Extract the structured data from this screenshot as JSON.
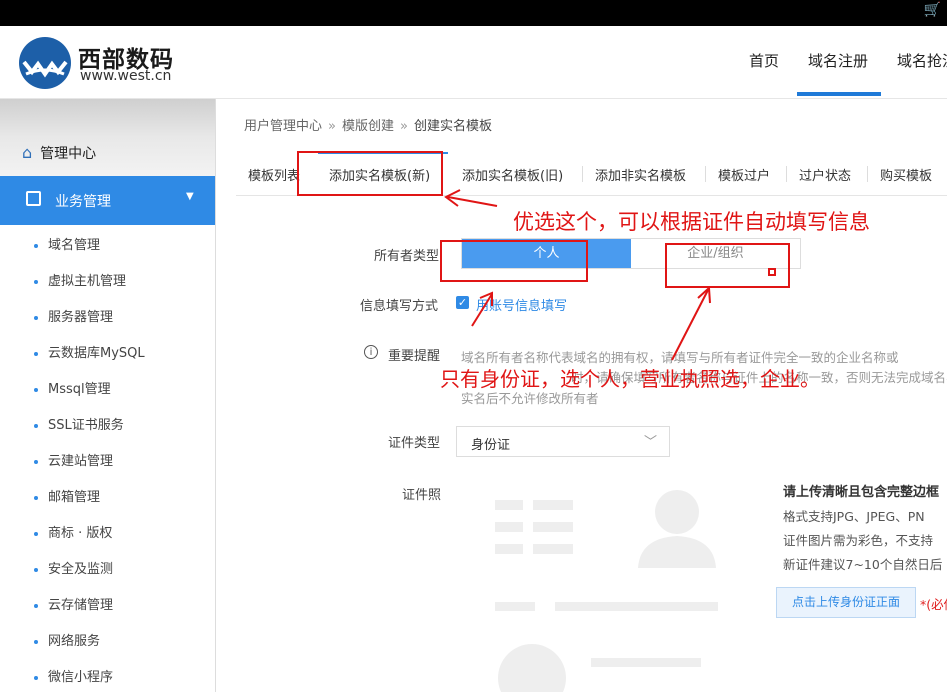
{
  "header": {
    "logo_cn": "西部数码",
    "logo_en": "www.west.cn",
    "nav": [
      "首页",
      "域名注册",
      "域名抢注"
    ]
  },
  "sidebar": {
    "home": "管理中心",
    "active": "业务管理",
    "items": [
      "域名管理",
      "虚拟主机管理",
      "服务器管理",
      "云数据库MySQL",
      "Mssql管理",
      "SSL证书服务",
      "云建站管理",
      "邮箱管理",
      "商标 · 版权",
      "安全及监测",
      "云存储管理",
      "网络服务",
      "微信小程序"
    ]
  },
  "breadcrumb": [
    "用户管理中心",
    "模版创建",
    "创建实名模板"
  ],
  "tabs": [
    "模板列表",
    "添加实名模板(新)",
    "添加实名模板(旧)",
    "添加非实名模板",
    "模板过户",
    "过户状态",
    "购买模板"
  ],
  "form": {
    "owner_type_label": "所有者类型",
    "owner_personal": "个人",
    "owner_company": "企业/组织",
    "fill_mode_label": "信息填写方式",
    "fill_mode_option": "用账号信息填写",
    "notice_label": "重要提醒",
    "notice_lines": [
      "域名所有者名称代表域名的拥有权，请填写与所有者证件完全一致的企业名称或",
      "时，请确保填写所有者名称与证件上的名称一致，否则无法完成域名实名",
      "实名后不允许修改所有者"
    ],
    "id_type_label": "证件类型",
    "id_type_value": "身份证",
    "id_photo_label": "证件照"
  },
  "upload": {
    "title": "请上传清晰且包含完整边框",
    "lines": [
      "格式支持JPG、JPEG、PN",
      "证件图片需为彩色，不支持",
      "新证件建议7~10个自然日后"
    ],
    "button": "点击上传身份证正面",
    "required": "*(必传)"
  },
  "annotations": {
    "top": "优选这个，可以根据证件自动填写信息",
    "middle": "只有身份证，选个人，营业执照选，企业。"
  },
  "colors": {
    "accent": "#2f8ae5",
    "annotation": "#e01515"
  }
}
